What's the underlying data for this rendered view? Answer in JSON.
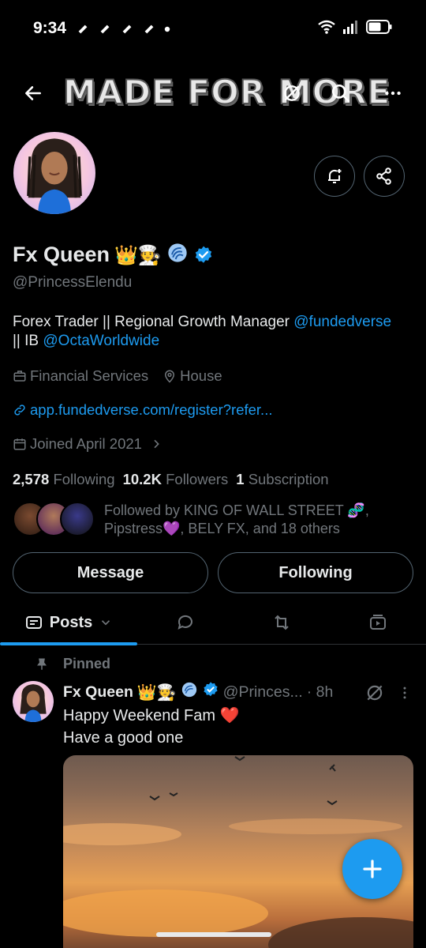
{
  "status_bar": {
    "time": "9:34"
  },
  "banner": {
    "text": "MADE FOR MORE"
  },
  "profile": {
    "name": "Fx Queen",
    "emojis": "👑🧑‍🍳",
    "handle": "@PrincessElendu",
    "bio_part1": "Forex Trader || Regional Growth Manager ",
    "bio_link1": "@fundedverse",
    "bio_part2": "|| IB ",
    "bio_link2": "@OctaWorldwide",
    "category": "Financial Services",
    "location": "House",
    "website": "app.fundedverse.com/register?refer...",
    "joined": "Joined April 2021",
    "following_count": "2,578",
    "following_label": "Following",
    "followers_count": "10.2K",
    "followers_label": "Followers",
    "subscriptions_count": "1",
    "subscriptions_label": "Subscription",
    "followed_by": "Followed by KING OF WALL STREET 🧬, Pipstress💜, BELY FX, and 18 others"
  },
  "actions": {
    "message": "Message",
    "following": "Following"
  },
  "tabs": {
    "posts": "Posts"
  },
  "post": {
    "pinned_label": "Pinned",
    "author_name": "Fx Queen",
    "author_emojis": "👑🧑‍🍳",
    "author_handle": "@Princes...",
    "time": "· 8h",
    "text_line1": "Happy Weekend Fam ❤️",
    "text_line2": "Have a good one"
  },
  "colors": {
    "accent": "#1d9bf0",
    "background": "#000000",
    "muted": "#71767b"
  }
}
